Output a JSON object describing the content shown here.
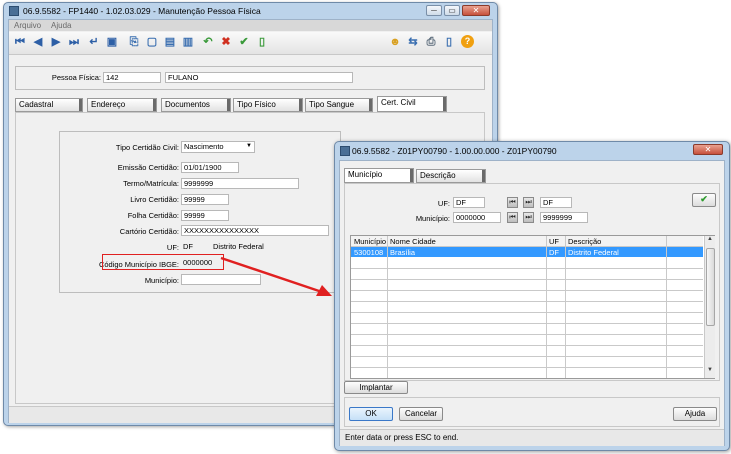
{
  "main_window": {
    "title": "06.9.5582 - FP1440 - 1.02.03.029 - Manutenção Pessoa Física",
    "min_glyph": "─",
    "max_glyph": "▭",
    "close_glyph": "✕",
    "menu": [
      "Arquivo",
      "Ajuda"
    ],
    "toolbar_icons": [
      "first-icon",
      "previous-icon",
      "next-icon",
      "last-icon",
      "enter-icon",
      "view-icon",
      "copy-icon",
      "new-icon",
      "edit-icon",
      "delete-icon",
      "undo-icon",
      "cancel-icon",
      "save-icon",
      "export-icon",
      "user-icon",
      "network-icon",
      "print-icon",
      "exit-icon",
      "help-icon"
    ],
    "person_label": "Pessoa Física:",
    "person_id": "142",
    "person_name": "FULANO",
    "tabs": [
      "Cadastral",
      "Endereço",
      "Documentos",
      "Tipo Físico",
      "Tipo Sangue",
      "Cert. Civil"
    ],
    "active_tab": "Cert. Civil",
    "form": {
      "tipo_label": "Tipo Certidão Civil:",
      "tipo_value": "Nascimento",
      "emissao_label": "Emissão Certidão:",
      "emissao_value": "01/01/1900",
      "termo_label": "Termo/Matrícula:",
      "termo_value": "9999999",
      "livro_label": "Livro Certidão:",
      "livro_value": "99999",
      "folha_label": "Folha Certidão:",
      "folha_value": "99999",
      "cartorio_label": "Cartório Certidão:",
      "cartorio_value": "XXXXXXXXXXXXXXX",
      "uf_label": "UF:",
      "uf_value": "DF",
      "uf_desc": "Distrito Federal",
      "ibge_label": "Código Município IBGE:",
      "ibge_value": "0000000",
      "municipio_label": "Município:",
      "municipio_value": ""
    }
  },
  "dialog": {
    "title": "06.9.5582 - Z01PY00790 - 1.00.00.000 - Z01PY00790",
    "close_glyph": "✕",
    "tabs": [
      "Município",
      "Descrição"
    ],
    "uf_label": "UF:",
    "uf_from": "DF",
    "uf_to": "DF",
    "municipio_label": "Município:",
    "mun_from": "0000000",
    "mun_to": "9999999",
    "confirm_glyph": "✔",
    "table": {
      "columns": [
        "Município",
        "Nome Cidade",
        "UF",
        "Descrição"
      ],
      "rows": [
        {
          "municipio": "5300108",
          "nome": "Brasília",
          "uf": "DF",
          "descricao": "Distrito Federal"
        }
      ]
    },
    "implantar_label": "Implantar",
    "ok_label": "OK",
    "cancel_label": "Cancelar",
    "help_label": "Ajuda",
    "status": "Enter data or press ESC to end."
  },
  "colors": {
    "window_frame": "#bcd3ea",
    "selection": "#3399ff",
    "highlight_box": "#e02020",
    "arrow": "#e02020"
  }
}
